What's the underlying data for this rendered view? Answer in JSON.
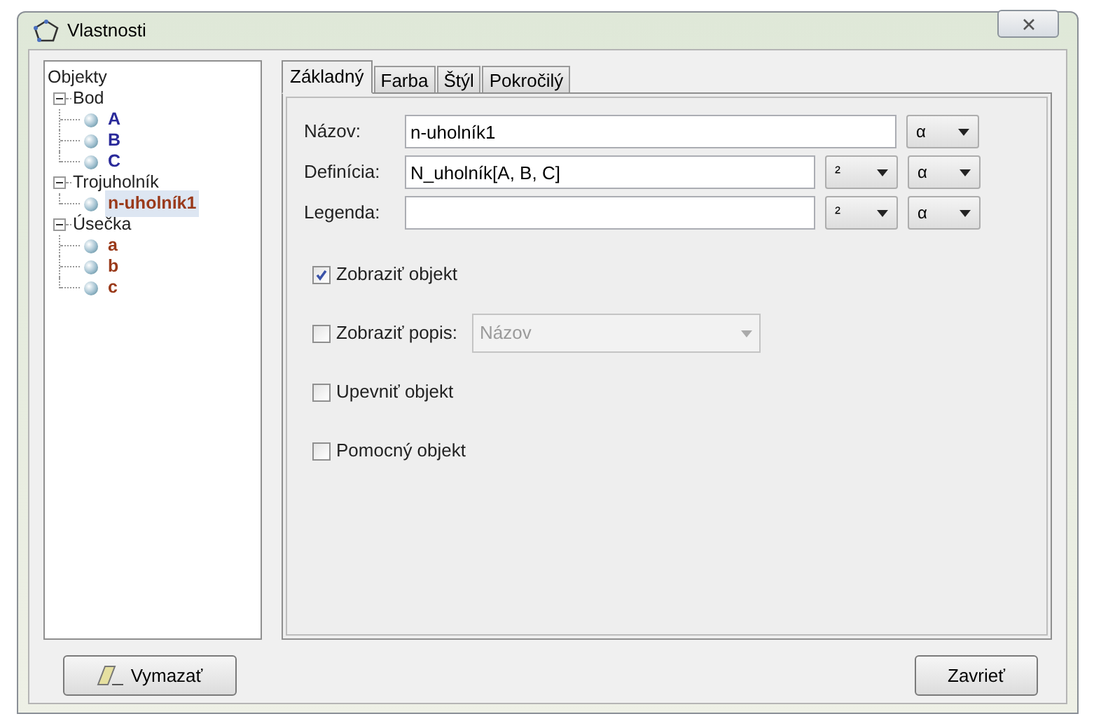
{
  "window": {
    "title": "Vlastnosti"
  },
  "tree": {
    "root": "Objekty",
    "children": [
      {
        "label": "Bod",
        "expanded": true,
        "children": [
          {
            "label": "A",
            "color": "#2a2a9a",
            "selected": false
          },
          {
            "label": "B",
            "color": "#2a2a9a",
            "selected": false
          },
          {
            "label": "C",
            "color": "#2a2a9a",
            "selected": false
          }
        ]
      },
      {
        "label": "Trojuholník",
        "expanded": true,
        "children": [
          {
            "label": "n-uholník1",
            "color": "#9a3a1a",
            "selected": true
          }
        ]
      },
      {
        "label": "Úsečka",
        "expanded": true,
        "children": [
          {
            "label": "a",
            "color": "#9a3a1a",
            "selected": false
          },
          {
            "label": "b",
            "color": "#9a3a1a",
            "selected": false
          },
          {
            "label": "c",
            "color": "#9a3a1a",
            "selected": false
          }
        ]
      }
    ]
  },
  "tabs": [
    {
      "label": "Základný",
      "selected": true
    },
    {
      "label": "Farba",
      "selected": false
    },
    {
      "label": "Štýl",
      "selected": false
    },
    {
      "label": "Pokročilý",
      "selected": false
    }
  ],
  "fields": [
    {
      "label": "Názov:",
      "value": "n-uholník1",
      "menus": [
        "α"
      ]
    },
    {
      "label": "Definícia:",
      "value": "N_uholník[A, B, C]",
      "menus": [
        "²",
        "α"
      ]
    },
    {
      "label": "Legenda:",
      "menus": [
        "²",
        "α"
      ]
    }
  ],
  "checkboxes": [
    {
      "label": "Zobraziť objekt",
      "checked": true
    },
    {
      "label": "Zobraziť popis:",
      "checked": false,
      "dropdown": {
        "value": "Názov",
        "disabled": true
      }
    },
    {
      "label": "Upevniť objekt",
      "checked": false
    },
    {
      "label": "Pomocný objekt",
      "checked": false
    }
  ],
  "buttons": {
    "delete": "Vymazať",
    "close": "Zavrieť"
  }
}
